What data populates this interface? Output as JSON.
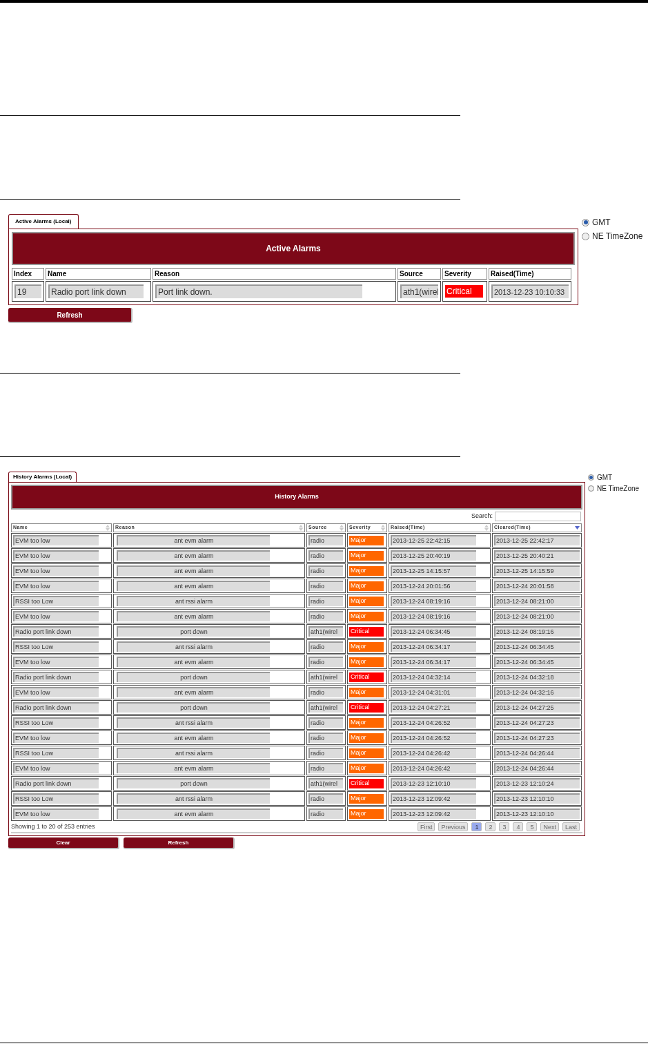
{
  "active": {
    "tab": {
      "label": "Active Alarms (Local)",
      "selected": true
    },
    "title": "Active Alarms",
    "timezones": [
      {
        "label": "GMT",
        "selected": true
      },
      {
        "label": "NE TimeZone",
        "selected": false
      }
    ],
    "columns": [
      "Index",
      "Name",
      "Reason",
      "Source",
      "Severity",
      "Raised(Time)"
    ],
    "rows": [
      {
        "cells": [
          "19",
          "Radio port link down",
          "Port link down.",
          "ath1(wirel",
          "Critical",
          "2013-12-23 10:10:33"
        ],
        "kind": "critical"
      }
    ],
    "buttons": [
      "Refresh"
    ]
  },
  "history": {
    "tab": {
      "label": "History Alarms (Local)",
      "selected": true
    },
    "title": "History Alarms",
    "timezones": [
      {
        "label": "GMT",
        "selected": true
      },
      {
        "label": "NE TimeZone",
        "selected": false
      }
    ],
    "search": {
      "label": "Search:"
    },
    "columns": [
      {
        "label": "Name",
        "sorted": false
      },
      {
        "label": "Reason",
        "sorted": false
      },
      {
        "label": "Source",
        "sorted": false
      },
      {
        "label": "Severity",
        "sorted": false
      },
      {
        "label": "Raised(Time)",
        "sorted": false
      },
      {
        "label": "Cleared(Time)",
        "sorted": true
      }
    ],
    "rows": [
      {
        "cells": [
          "EVM too low",
          "ant evm alarm",
          "radio",
          "Major",
          "2013-12-25 22:42:15",
          "2013-12-25 22:42:17"
        ],
        "kind": "major"
      },
      {
        "cells": [
          "EVM too low",
          "ant evm alarm",
          "radio",
          "Major",
          "2013-12-25 20:40:19",
          "2013-12-25 20:40:21"
        ],
        "kind": "major"
      },
      {
        "cells": [
          "EVM too low",
          "ant evm alarm",
          "radio",
          "Major",
          "2013-12-25 14:15:57",
          "2013-12-25 14:15:59"
        ],
        "kind": "major"
      },
      {
        "cells": [
          "EVM too low",
          "ant evm alarm",
          "radio",
          "Major",
          "2013-12-24 20:01:56",
          "2013-12-24 20:01:58"
        ],
        "kind": "major"
      },
      {
        "cells": [
          "RSSI too Low",
          "ant rssi alarm",
          "radio",
          "Major",
          "2013-12-24 08:19:16",
          "2013-12-24 08:21:00"
        ],
        "kind": "major"
      },
      {
        "cells": [
          "EVM too low",
          "ant evm alarm",
          "radio",
          "Major",
          "2013-12-24 08:19:16",
          "2013-12-24 08:21:00"
        ],
        "kind": "major"
      },
      {
        "cells": [
          "Radio port link down",
          "port down",
          "ath1(wirel",
          "Critical",
          "2013-12-24 06:34:45",
          "2013-12-24 08:19:16"
        ],
        "kind": "critical"
      },
      {
        "cells": [
          "RSSI too Low",
          "ant rssi alarm",
          "radio",
          "Major",
          "2013-12-24 06:34:17",
          "2013-12-24 06:34:45"
        ],
        "kind": "major"
      },
      {
        "cells": [
          "EVM too low",
          "ant evm alarm",
          "radio",
          "Major",
          "2013-12-24 06:34:17",
          "2013-12-24 06:34:45"
        ],
        "kind": "major"
      },
      {
        "cells": [
          "Radio port link down",
          "port down",
          "ath1(wirel",
          "Critical",
          "2013-12-24 04:32:14",
          "2013-12-24 04:32:18"
        ],
        "kind": "critical"
      },
      {
        "cells": [
          "EVM too low",
          "ant evm alarm",
          "radio",
          "Major",
          "2013-12-24 04:31:01",
          "2013-12-24 04:32:16"
        ],
        "kind": "major"
      },
      {
        "cells": [
          "Radio port link down",
          "port down",
          "ath1(wirel",
          "Critical",
          "2013-12-24 04:27:21",
          "2013-12-24 04:27:25"
        ],
        "kind": "critical"
      },
      {
        "cells": [
          "RSSI too Low",
          "ant rssi alarm",
          "radio",
          "Major",
          "2013-12-24 04:26:52",
          "2013-12-24 04:27:23"
        ],
        "kind": "major"
      },
      {
        "cells": [
          "EVM too low",
          "ant evm alarm",
          "radio",
          "Major",
          "2013-12-24 04:26:52",
          "2013-12-24 04:27:23"
        ],
        "kind": "major"
      },
      {
        "cells": [
          "RSSI too Low",
          "ant rssi alarm",
          "radio",
          "Major",
          "2013-12-24 04:26:42",
          "2013-12-24 04:26:44"
        ],
        "kind": "major"
      },
      {
        "cells": [
          "EVM too low",
          "ant evm alarm",
          "radio",
          "Major",
          "2013-12-24 04:26:42",
          "2013-12-24 04:26:44"
        ],
        "kind": "major"
      },
      {
        "cells": [
          "Radio port link down",
          "port down",
          "ath1(wirel",
          "Critical",
          "2013-12-23 12:10:10",
          "2013-12-23 12:10:24"
        ],
        "kind": "critical"
      },
      {
        "cells": [
          "RSSI too Low",
          "ant rssi alarm",
          "radio",
          "Major",
          "2013-12-23 12:09:42",
          "2013-12-23 12:10:10"
        ],
        "kind": "major"
      },
      {
        "cells": [
          "EVM too low",
          "ant evm alarm",
          "radio",
          "Major",
          "2013-12-23 12:09:42",
          "2013-12-23 12:10:10"
        ],
        "kind": "major"
      }
    ],
    "info": "Showing 1 to 20 of 253 entries",
    "pages": [
      {
        "label": "First",
        "selected": false
      },
      {
        "label": "Previous",
        "selected": false
      },
      {
        "label": "1",
        "selected": true
      },
      {
        "label": "2",
        "selected": false
      },
      {
        "label": "3",
        "selected": false
      },
      {
        "label": "4",
        "selected": false
      },
      {
        "label": "5",
        "selected": false
      },
      {
        "label": "Next",
        "selected": false
      },
      {
        "label": "Last",
        "selected": false
      }
    ],
    "buttons": [
      "Clear",
      "Refresh"
    ]
  }
}
